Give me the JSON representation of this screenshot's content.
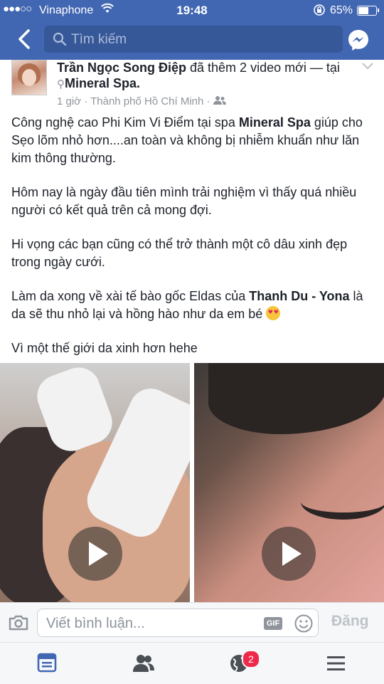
{
  "status_bar": {
    "carrier": "Vinaphone",
    "time": "19:48",
    "battery_percent": "65%",
    "battery_level": 0.65
  },
  "header": {
    "search_placeholder": "Tìm kiếm",
    "colors": {
      "bar": "#4267b2",
      "search_bg": "#365899"
    }
  },
  "post": {
    "author": "Trần Ngọc Song Điệp",
    "action": " đã thêm 2 video mới — tại",
    "place": "Mineral Spa.",
    "time": "1 giờ",
    "location": "Thành phố Hồ Chí Minh",
    "privacy_icon": "friends-icon",
    "paragraphs": {
      "p1_a": "Công nghệ cao Phi Kim Vi Điểm tại spa ",
      "p1_b": "Mineral Spa",
      "p1_c": " giúp cho Sẹo lõm nhỏ hơn....an toàn và không bị nhiễm khuẩn như lăn kim thông thường.",
      "p2": "Hôm nay là ngày đầu tiên mình trải nghiệm vì thấy quá nhiều người có kết quả trên cả mong đợi.",
      "p3": "Hi vọng các bạn cũng có thể trở thành một cô dâu xinh đẹp trong ngày cưới.",
      "p4_a": "Làm da xong về xài tế bào gốc Eldas của ",
      "p4_b": "Thanh Du - Yona",
      "p4_c": " là da sẽ thu nhỏ lại và hồng hào như da em bé ",
      "p4_emoji": "heart-eyes-emoji",
      "p5": "Vì một thế giới da xinh hơn hehe"
    },
    "videos": [
      {
        "icon": "play-icon"
      },
      {
        "icon": "play-icon"
      }
    ]
  },
  "comment_bar": {
    "placeholder": "Viết bình luận...",
    "gif_label": "GIF",
    "post_label": "Đăng"
  },
  "tab_bar": {
    "items": [
      {
        "icon": "news-feed-icon",
        "active": true
      },
      {
        "icon": "friends-icon"
      },
      {
        "icon": "globe-notifications-icon",
        "badge": "2"
      },
      {
        "icon": "menu-icon"
      }
    ],
    "active_color": "#4267b2",
    "inactive_color": "#4b4f56",
    "badge_color": "#f02849"
  }
}
